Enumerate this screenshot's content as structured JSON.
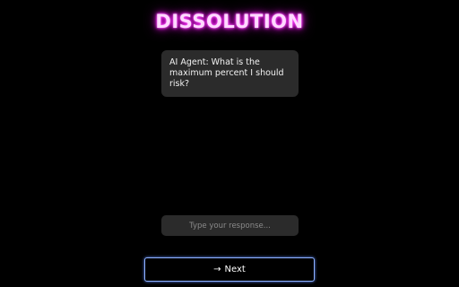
{
  "app": {
    "title": "DISSOLUTION"
  },
  "chat": {
    "message": "AI Agent: What is the maximum percent I should risk?"
  },
  "response": {
    "placeholder": "Type your response...",
    "value": ""
  },
  "actions": {
    "next_icon": "arrow-right-icon",
    "next_label": "Next"
  },
  "colors": {
    "background": "#000000",
    "title_glow": "#ff33ff",
    "bubble": "#2b2b2b",
    "button_border": "#8fb2ff"
  }
}
